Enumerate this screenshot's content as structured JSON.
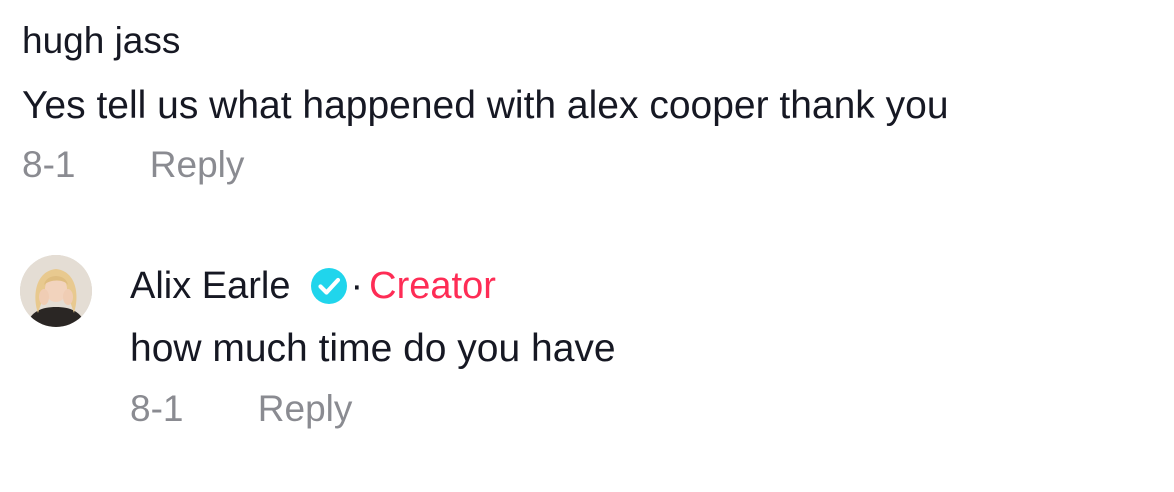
{
  "comment": {
    "username": "hugh jass",
    "text": "Yes tell us what happened with alex cooper thank you",
    "date": "8-1",
    "reply_label": "Reply"
  },
  "reply": {
    "name": "Alix Earle",
    "badge_icon": "verified-check-icon",
    "badge_color": "#20d5ec",
    "separator": "·",
    "role_label": "Creator",
    "role_color": "#fe2c55",
    "text": "how much time do you have",
    "date": "8-1",
    "reply_label": "Reply"
  }
}
